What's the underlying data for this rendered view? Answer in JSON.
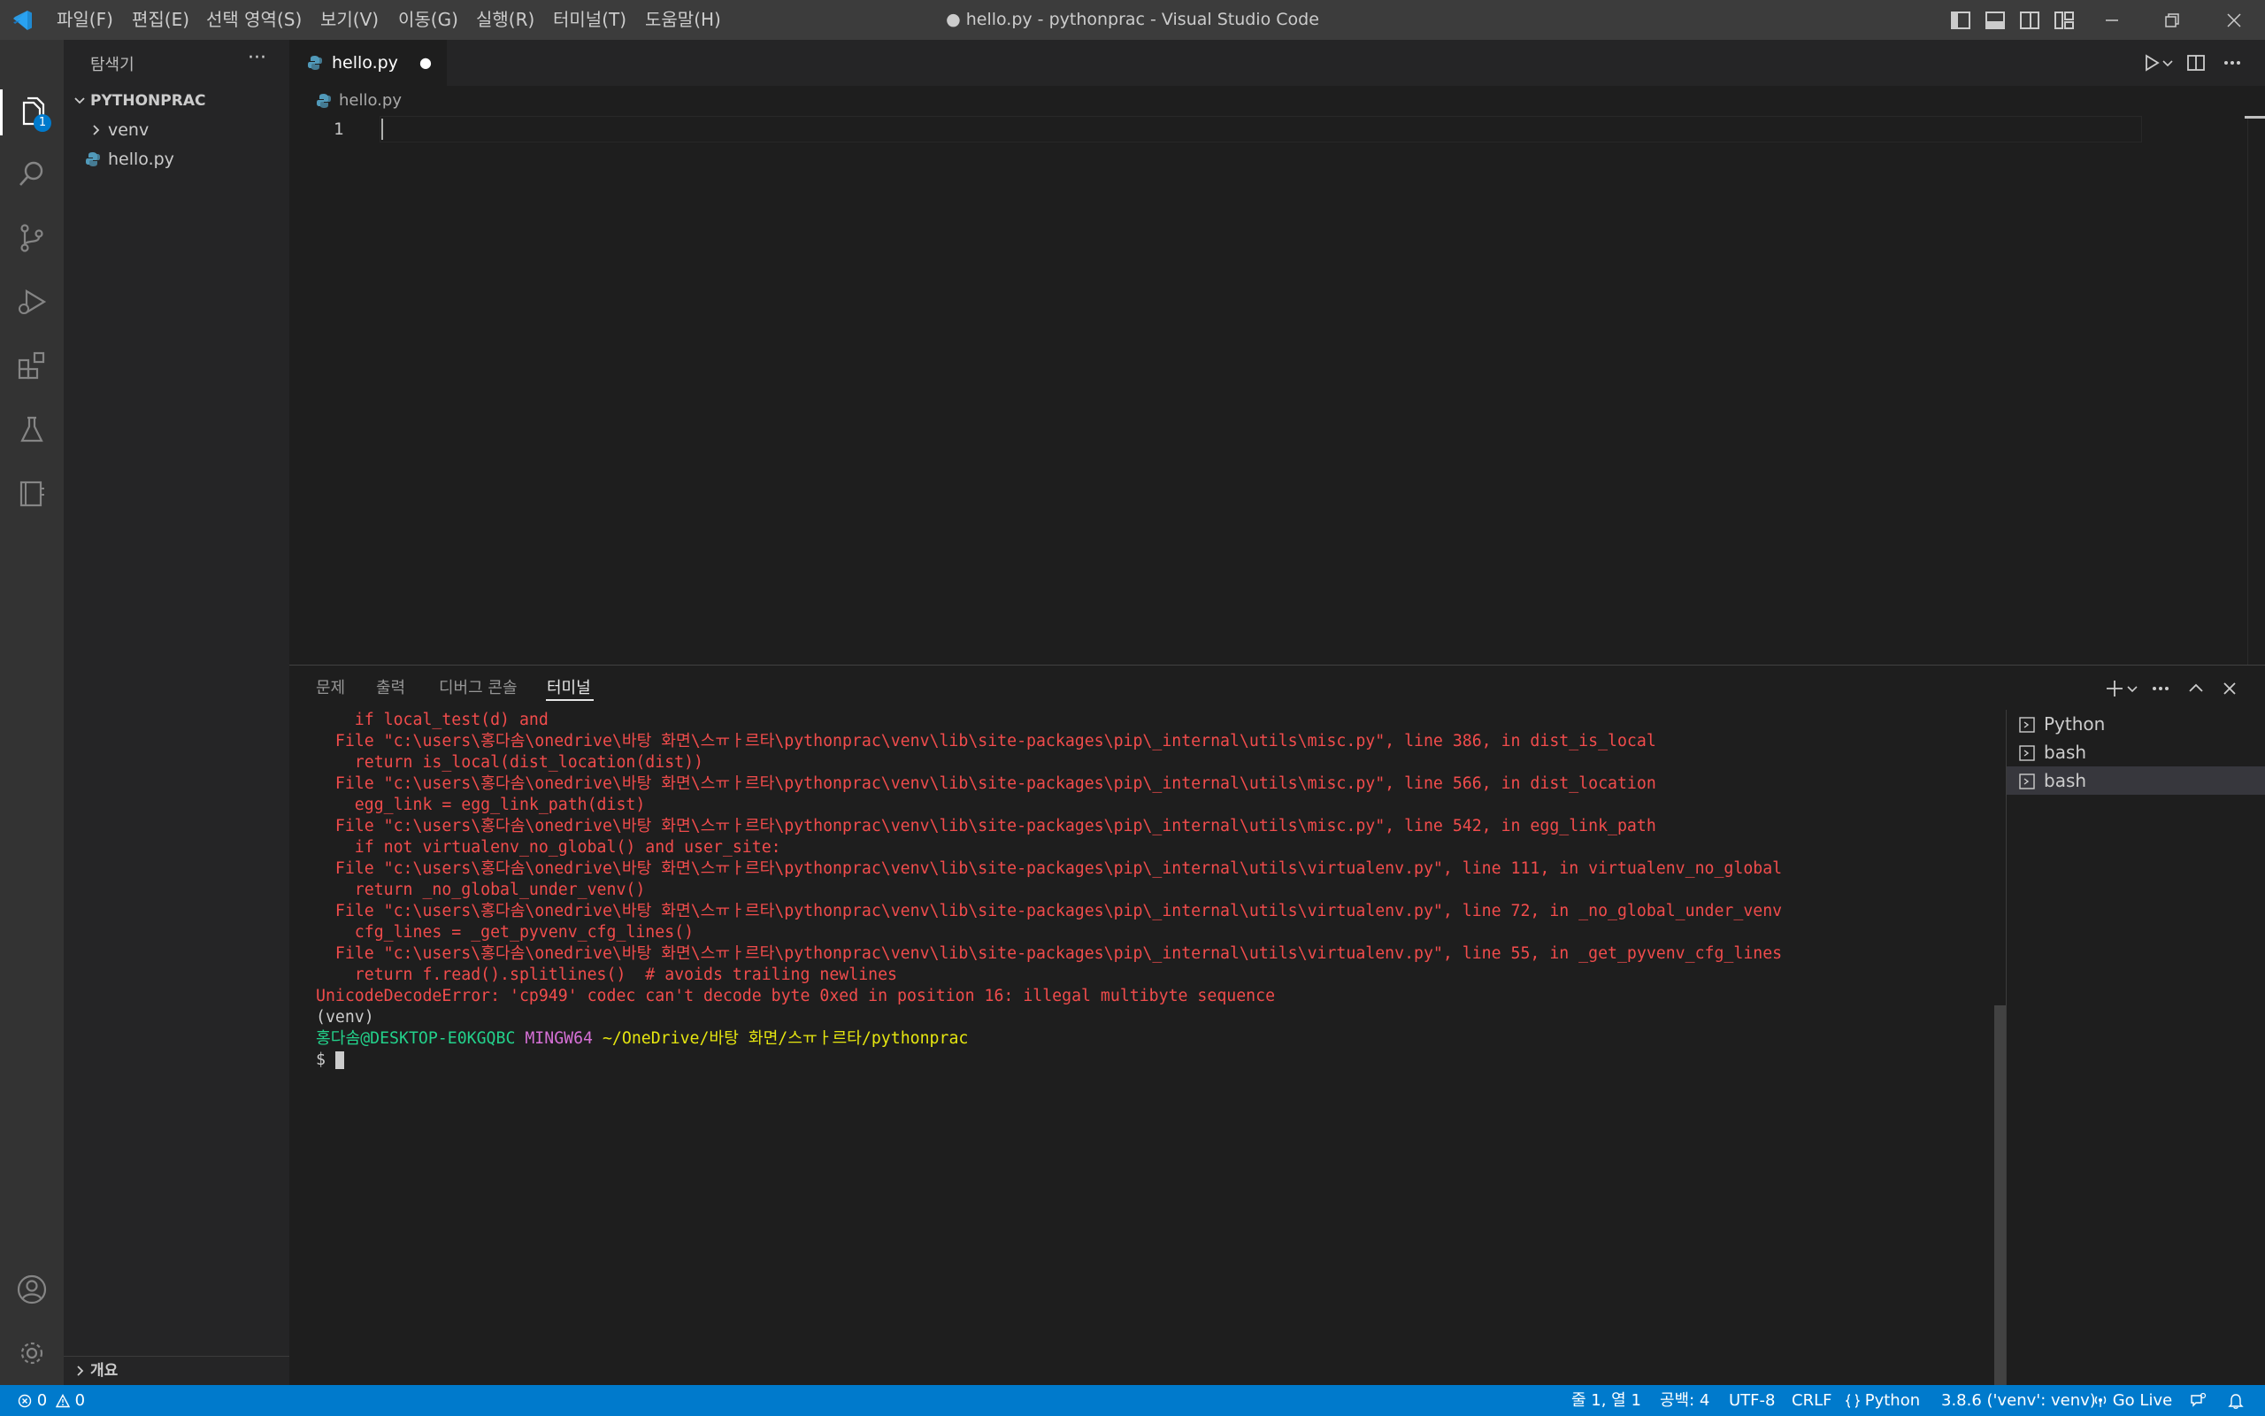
{
  "titlebar": {
    "title": "● hello.py - pythonprac - Visual Studio Code",
    "menu": [
      "파일(F)",
      "편집(E)",
      "선택 영역(S)",
      "보기(V)",
      "이동(G)",
      "실행(R)",
      "터미널(T)",
      "도움말(H)"
    ]
  },
  "activitybar": {
    "explorer_badge": "1"
  },
  "sidebar": {
    "title": "탐색기",
    "more": "···",
    "root_folder": "PYTHONPRAC",
    "items": [
      {
        "label": "venv",
        "type": "folder"
      },
      {
        "label": "hello.py",
        "type": "python-file"
      }
    ],
    "outline_label": "개요"
  },
  "editor": {
    "tab_label": "hello.py",
    "tab_dirty_marker": "●",
    "breadcrumb_file": "hello.py",
    "line_numbers": [
      "1"
    ]
  },
  "panel": {
    "tabs": [
      "문제",
      "출력",
      "디버그 콘솔",
      "터미널"
    ],
    "active_tab": "터미널",
    "terminal_lines": [
      "    if local_test(d) and",
      "  File \"c:\\users\\홍다솜\\onedrive\\바탕 화면\\스ㅠㅏ르타\\pythonprac\\venv\\lib\\site-packages\\pip\\_internal\\utils\\misc.py\", line 386, in dist_is_local",
      "    return is_local(dist_location(dist))",
      "  File \"c:\\users\\홍다솜\\onedrive\\바탕 화면\\스ㅠㅏ르타\\pythonprac\\venv\\lib\\site-packages\\pip\\_internal\\utils\\misc.py\", line 566, in dist_location",
      "    egg_link = egg_link_path(dist)",
      "  File \"c:\\users\\홍다솜\\onedrive\\바탕 화면\\스ㅠㅏ르타\\pythonprac\\venv\\lib\\site-packages\\pip\\_internal\\utils\\misc.py\", line 542, in egg_link_path",
      "    if not virtualenv_no_global() and user_site:",
      "  File \"c:\\users\\홍다솜\\onedrive\\바탕 화면\\스ㅠㅏ르타\\pythonprac\\venv\\lib\\site-packages\\pip\\_internal\\utils\\virtualenv.py\", line 111, in virtualenv_no_global",
      "    return _no_global_under_venv()",
      "  File \"c:\\users\\홍다솜\\onedrive\\바탕 화면\\스ㅠㅏ르타\\pythonprac\\venv\\lib\\site-packages\\pip\\_internal\\utils\\virtualenv.py\", line 72, in _no_global_under_venv",
      "    cfg_lines = _get_pyvenv_cfg_lines()",
      "  File \"c:\\users\\홍다솜\\onedrive\\바탕 화면\\스ㅠㅏ르타\\pythonprac\\venv\\lib\\site-packages\\pip\\_internal\\utils\\virtualenv.py\", line 55, in _get_pyvenv_cfg_lines",
      "    return f.read().splitlines()  # avoids trailing newlines",
      "UnicodeDecodeError: 'cp949' codec can't decode byte 0xed in position 16: illegal multibyte sequence"
    ],
    "venv_line": "(venv)",
    "prompt": {
      "user": "홍다솜@DESKTOP-E0KGQBC",
      "shell": "MINGW64",
      "path": "~/OneDrive/바탕 화면/스ㅠㅏ르타/pythonprac",
      "symbol": "$"
    },
    "terminals": [
      "Python",
      "bash",
      "bash"
    ]
  },
  "statusbar": {
    "errors": "0",
    "warnings": "0",
    "position": "줄 1, 열 1",
    "spaces": "공백: 4",
    "encoding": "UTF-8",
    "eol": "CRLF",
    "language": "Python",
    "interpreter": "3.8.6 ('venv': venv)",
    "golive": "Go Live"
  },
  "colors": {
    "statusbar": "#007acc",
    "terminal_error": "#f14c4c",
    "prompt_user": "#23d18b",
    "prompt_shell": "#d670d6",
    "prompt_path": "#e5e510",
    "python_icon": "#519aba"
  }
}
